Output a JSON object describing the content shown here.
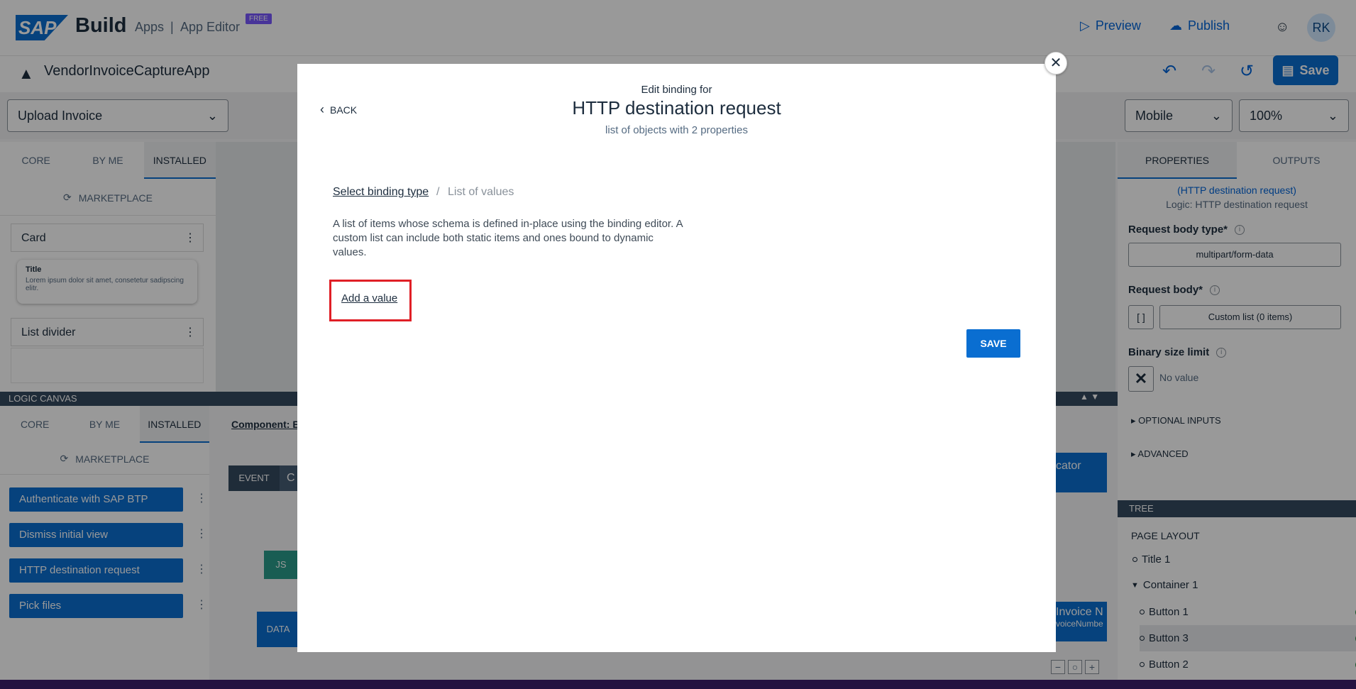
{
  "shell": {
    "logo": "SAP",
    "product": "Build",
    "apps": "Apps",
    "separator": "|",
    "editor": "App Editor",
    "badge": "FREE",
    "preview": "Preview",
    "publish": "Publish",
    "avatar_initials": "RK"
  },
  "appbar": {
    "app_name": "VendorInvoiceCaptureApp",
    "save_label": "Save"
  },
  "pagebar": {
    "page_value": "Upload Invoice",
    "device_value": "Mobile",
    "zoom_value": "100%"
  },
  "left_panel": {
    "tabs": [
      {
        "label": "CORE"
      },
      {
        "label": "BY ME"
      },
      {
        "label": "INSTALLED"
      }
    ],
    "marketplace": "MARKETPLACE",
    "components": [
      {
        "label": "Card"
      },
      {
        "label": "List divider"
      }
    ],
    "card_preview": {
      "title": "Title",
      "body": "Lorem ipsum dolor sit amet, consetetur sadipscing elitr."
    }
  },
  "logic_canvas": {
    "header": "LOGIC CANVAS",
    "tabs": [
      {
        "label": "CORE"
      },
      {
        "label": "BY ME"
      },
      {
        "label": "INSTALLED"
      }
    ],
    "component_link": "Component: B",
    "marketplace": "MARKETPLACE",
    "flow_functions": [
      {
        "label": "Authenticate with SAP BTP"
      },
      {
        "label": "Dismiss initial view"
      },
      {
        "label": "HTTP destination request"
      },
      {
        "label": "Pick files"
      }
    ],
    "nodes": {
      "event": "EVENT",
      "event_suffix": "C",
      "js": "JS",
      "data": "DATA",
      "right_node": "cator",
      "right_node2_line1": "Invoice N",
      "right_node2_line2": "voiceNumbe"
    }
  },
  "right_panel": {
    "tabs": [
      {
        "label": "PROPERTIES"
      },
      {
        "label": "OUTPUTS"
      }
    ],
    "context_link": "(HTTP destination request)",
    "context_sub": "Logic: HTTP destination request",
    "request_body_type_label": "Request body type*",
    "request_body_type_value": "multipart/form-data",
    "request_body_label": "Request body*",
    "request_body_value": "Custom list (0 items)",
    "binary_size_label": "Binary size limit",
    "binary_size_value": "No value",
    "optional_inputs": "OPTIONAL INPUTS",
    "advanced": "ADVANCED"
  },
  "tree": {
    "header": "TREE",
    "root": "PAGE LAYOUT",
    "items": [
      {
        "label": "Title 1"
      },
      {
        "label": "Container 1"
      },
      {
        "label": "Button 1"
      },
      {
        "label": "Button 3"
      },
      {
        "label": "Button 2"
      }
    ]
  },
  "dialog": {
    "back": "BACK",
    "caption": "Edit binding for",
    "title": "HTTP destination request",
    "subtitle": "list of objects with 2 properties",
    "crumb_link": "Select binding type",
    "crumb_sep": "/",
    "crumb_current": "List of values",
    "description": "A list of items whose schema is defined in-place using the binding editor. A custom list can include both static items and ones bound to dynamic values.",
    "add_value": "Add a value",
    "save": "SAVE"
  },
  "colors": {
    "accent": "#0a6ed1",
    "highlight": "#e01f26",
    "header_dark": "#354a5f"
  }
}
